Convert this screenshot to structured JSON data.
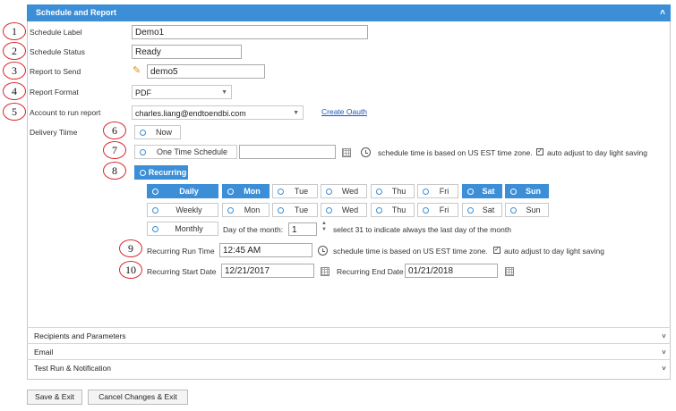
{
  "header": {
    "title": "Schedule and Report"
  },
  "markers": [
    "1",
    "2",
    "3",
    "4",
    "5",
    "6",
    "7",
    "8",
    "9",
    "10"
  ],
  "fields": {
    "schedule_label": {
      "label": "Schedule Label",
      "value": "Demo1"
    },
    "schedule_status": {
      "label": "Schedule Status",
      "value": "Ready"
    },
    "report_to_send": {
      "label": "Report to Send",
      "value": "demo5"
    },
    "report_format": {
      "label": "Report Format",
      "value": "PDF"
    },
    "account": {
      "label": "Account to run report",
      "value": "charles.liang@endtoendbi.com",
      "link": "Create Oauth"
    },
    "delivery_time": {
      "label": "Delivery Tiime"
    }
  },
  "delivery": {
    "now": "Now",
    "one_time": "One Time Schedule",
    "est_note": "schedule time is based on US EST time zone.",
    "auto_adjust": "auto adjust to day light saving",
    "recurring": "Recurring"
  },
  "rows": {
    "daily": {
      "label": "Daily",
      "days": [
        "Mon",
        "Tue",
        "Wed",
        "Thu",
        "Fri",
        "Sat",
        "Sun"
      ]
    },
    "weekly": {
      "label": "Weekly",
      "days": [
        "Mon",
        "Tue",
        "Wed",
        "Thu",
        "Fri",
        "Sat",
        "Sun"
      ]
    },
    "monthly": {
      "label": "Monthly",
      "dom_label": "Day of the month:",
      "dom_value": "1",
      "note": "select 31 to indicate always the last day of the month"
    }
  },
  "recurring": {
    "run_time_label": "Recurring Run Time",
    "run_time": "12:45 AM",
    "start_label": "Recurring Start Date",
    "start": "12/21/2017",
    "end_label": "Recurring End Date",
    "end": "01/21/2018"
  },
  "sections": [
    "Recipients and Parameters",
    "Email",
    "Test Run & Notification"
  ],
  "buttons": {
    "save": "Save & Exit",
    "cancel": "Cancel Changes & Exit"
  },
  "colors": {
    "accent": "#3c8fd7",
    "marker": "#d8262c",
    "link": "#1a56b8"
  }
}
